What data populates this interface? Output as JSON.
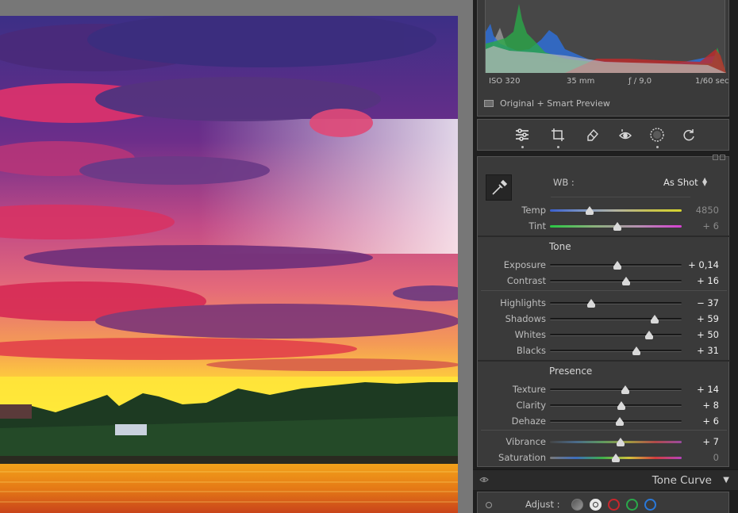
{
  "histogram": {
    "exif": {
      "iso": "ISO 320",
      "focal": "35 mm",
      "aperture": "ƒ / 9,0",
      "shutter": "1/60 sec"
    },
    "preview_label": "Original + Smart Preview"
  },
  "toolbar": {
    "tools": [
      "edit-sliders",
      "crop",
      "healing-brush",
      "red-eye",
      "masking",
      "reset"
    ]
  },
  "basic": {
    "wb_label": "WB :",
    "wb_value": "As Shot",
    "wb_arrows": "⌃\n⌄",
    "sliders": [
      {
        "id": "temp",
        "label": "Temp",
        "value": "4850",
        "pos": 0.3,
        "dim": true
      },
      {
        "id": "tint",
        "label": "Tint",
        "value": "+ 6",
        "pos": 0.515,
        "dim": true
      },
      {
        "id": "exposure",
        "label": "Exposure",
        "value": "+ 0,14",
        "pos": 0.514
      },
      {
        "id": "contrast",
        "label": "Contrast",
        "value": "+ 16",
        "pos": 0.58
      },
      {
        "id": "highlights",
        "label": "Highlights",
        "value": "− 37",
        "pos": 0.315
      },
      {
        "id": "shadows",
        "label": "Shadows",
        "value": "+ 59",
        "pos": 0.795
      },
      {
        "id": "whites",
        "label": "Whites",
        "value": "+ 50",
        "pos": 0.75
      },
      {
        "id": "blacks",
        "label": "Blacks",
        "value": "+ 31",
        "pos": 0.655
      },
      {
        "id": "texture",
        "label": "Texture",
        "value": "+ 14",
        "pos": 0.57
      },
      {
        "id": "clarity",
        "label": "Clarity",
        "value": "+ 8",
        "pos": 0.54
      },
      {
        "id": "dehaze",
        "label": "Dehaze",
        "value": "+ 6",
        "pos": 0.53
      },
      {
        "id": "vibrance",
        "label": "Vibrance",
        "value": "+ 7",
        "pos": 0.535
      },
      {
        "id": "saturation",
        "label": "Saturation",
        "value": "0",
        "pos": 0.5,
        "dim": true
      }
    ],
    "tone_title": "Tone",
    "presence_title": "Presence"
  },
  "tone_curve": {
    "title": "Tone Curve",
    "toggle": "▼",
    "adjust_label": "Adjust :"
  },
  "colors": {
    "panel_bg": "#3a3a3a",
    "track": "#1e1e1e",
    "channel_red": "#c8262c",
    "channel_green": "#2aa84a",
    "channel_blue": "#2a78d8"
  }
}
